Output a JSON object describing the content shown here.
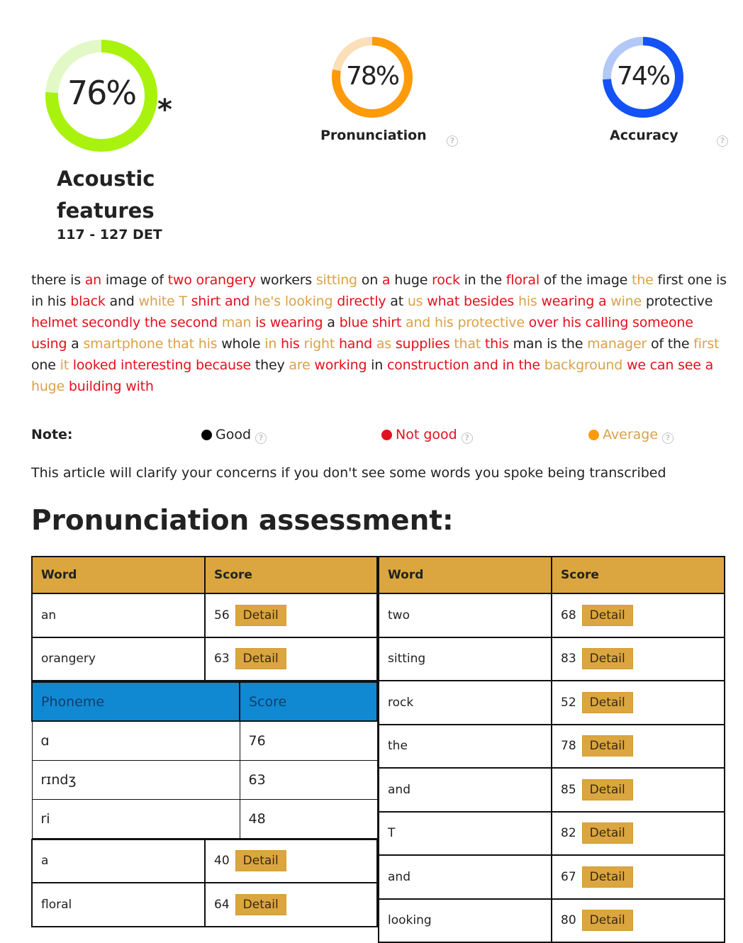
{
  "scores": {
    "overall": {
      "value": 76,
      "display": "76%",
      "marker": "*",
      "label_line1": "Acoustic",
      "label_line2": "features",
      "range": "117 - 127 DET",
      "color": "#a8f20e",
      "track_color": "#e2f9c7"
    },
    "pronunciation": {
      "value": 78,
      "display": "78%",
      "label": "Pronunciation",
      "color": "#ff9a0a",
      "track_color": "#fbdfb8"
    },
    "accuracy": {
      "value": 74,
      "display": "74%",
      "label": "Accuracy",
      "color": "#1452f5",
      "track_color": "#b3c8f7"
    },
    "help_glyph": "?"
  },
  "transcript": [
    {
      "t": "there",
      "q": "good"
    },
    {
      "t": "is",
      "q": "good"
    },
    {
      "t": "an",
      "q": "bad"
    },
    {
      "t": "image",
      "q": "good"
    },
    {
      "t": "of",
      "q": "good"
    },
    {
      "t": "two",
      "q": "bad"
    },
    {
      "t": "orangery",
      "q": "bad"
    },
    {
      "t": "workers",
      "q": "good"
    },
    {
      "t": "sitting",
      "q": "avg"
    },
    {
      "t": "on",
      "q": "good"
    },
    {
      "t": "a",
      "q": "bad"
    },
    {
      "t": "huge",
      "q": "good"
    },
    {
      "t": "rock",
      "q": "bad"
    },
    {
      "t": "in",
      "q": "good"
    },
    {
      "t": "the",
      "q": "good"
    },
    {
      "t": "floral",
      "q": "bad"
    },
    {
      "t": "of",
      "q": "good"
    },
    {
      "t": "the",
      "q": "good"
    },
    {
      "t": "image",
      "q": "good"
    },
    {
      "t": "the",
      "q": "avg"
    },
    {
      "t": "first",
      "q": "good"
    },
    {
      "t": "one",
      "q": "good"
    },
    {
      "t": "is",
      "q": "good"
    },
    {
      "t": "in",
      "q": "good"
    },
    {
      "t": "his",
      "q": "good"
    },
    {
      "t": "black",
      "q": "bad"
    },
    {
      "t": "and",
      "q": "good"
    },
    {
      "t": "white",
      "q": "avg"
    },
    {
      "t": "T",
      "q": "avg"
    },
    {
      "t": "shirt",
      "q": "bad"
    },
    {
      "t": "and",
      "q": "bad"
    },
    {
      "t": "he's",
      "q": "avg"
    },
    {
      "t": "looking",
      "q": "avg"
    },
    {
      "t": "directly",
      "q": "bad"
    },
    {
      "t": "at",
      "q": "good"
    },
    {
      "t": "us",
      "q": "avg"
    },
    {
      "t": "what",
      "q": "bad"
    },
    {
      "t": "besides",
      "q": "bad"
    },
    {
      "t": "his",
      "q": "avg"
    },
    {
      "t": "wearing",
      "q": "bad"
    },
    {
      "t": "a",
      "q": "bad"
    },
    {
      "t": "wine",
      "q": "avg"
    },
    {
      "t": "protective",
      "q": "good"
    },
    {
      "t": "helmet",
      "q": "bad"
    },
    {
      "t": "secondly",
      "q": "bad"
    },
    {
      "t": "the",
      "q": "bad"
    },
    {
      "t": "second",
      "q": "bad"
    },
    {
      "t": "man",
      "q": "avg"
    },
    {
      "t": "is",
      "q": "bad"
    },
    {
      "t": "wearing",
      "q": "bad"
    },
    {
      "t": "a",
      "q": "good"
    },
    {
      "t": "blue",
      "q": "bad"
    },
    {
      "t": "shirt",
      "q": "bad"
    },
    {
      "t": "and",
      "q": "avg"
    },
    {
      "t": "his",
      "q": "avg"
    },
    {
      "t": "protective",
      "q": "avg"
    },
    {
      "t": "over",
      "q": "bad"
    },
    {
      "t": "his",
      "q": "bad"
    },
    {
      "t": "calling",
      "q": "bad"
    },
    {
      "t": "someone",
      "q": "bad"
    },
    {
      "t": "using",
      "q": "bad"
    },
    {
      "t": "a",
      "q": "good"
    },
    {
      "t": "smartphone",
      "q": "avg"
    },
    {
      "t": "that",
      "q": "avg"
    },
    {
      "t": "his",
      "q": "avg"
    },
    {
      "t": "whole",
      "q": "good"
    },
    {
      "t": "in",
      "q": "avg"
    },
    {
      "t": "his",
      "q": "bad"
    },
    {
      "t": "right",
      "q": "avg"
    },
    {
      "t": "hand",
      "q": "bad"
    },
    {
      "t": "as",
      "q": "avg"
    },
    {
      "t": "supplies",
      "q": "bad"
    },
    {
      "t": "that",
      "q": "avg"
    },
    {
      "t": "this",
      "q": "bad"
    },
    {
      "t": "man",
      "q": "good"
    },
    {
      "t": "is",
      "q": "good"
    },
    {
      "t": "the",
      "q": "good"
    },
    {
      "t": "manager",
      "q": "avg"
    },
    {
      "t": "of",
      "q": "good"
    },
    {
      "t": "the",
      "q": "good"
    },
    {
      "t": "first",
      "q": "avg"
    },
    {
      "t": "one",
      "q": "good"
    },
    {
      "t": "it",
      "q": "avg"
    },
    {
      "t": "looked",
      "q": "bad"
    },
    {
      "t": "interesting",
      "q": "bad"
    },
    {
      "t": "because",
      "q": "bad"
    },
    {
      "t": "they",
      "q": "good"
    },
    {
      "t": "are",
      "q": "avg"
    },
    {
      "t": "working",
      "q": "bad"
    },
    {
      "t": "in",
      "q": "good"
    },
    {
      "t": "construction",
      "q": "bad"
    },
    {
      "t": "and",
      "q": "bad"
    },
    {
      "t": "in",
      "q": "bad"
    },
    {
      "t": "the",
      "q": "bad"
    },
    {
      "t": "background",
      "q": "avg"
    },
    {
      "t": "we",
      "q": "bad"
    },
    {
      "t": "can",
      "q": "bad"
    },
    {
      "t": "see",
      "q": "bad"
    },
    {
      "t": "a",
      "q": "bad"
    },
    {
      "t": "huge",
      "q": "avg"
    },
    {
      "t": "building",
      "q": "bad"
    },
    {
      "t": "with",
      "q": "bad"
    }
  ],
  "legend": {
    "note_label": "Note:",
    "good": {
      "label": "Good",
      "color": "#000000"
    },
    "bad": {
      "label": "Not good",
      "color": "#e3101d"
    },
    "avg": {
      "label": "Average",
      "color": "#ff9a0a"
    }
  },
  "article_note": "This article will clarify your concerns if you don't see some words you spoke being transcribed",
  "assessment": {
    "title": "Pronunciation assessment:",
    "headers": {
      "word": "Word",
      "score": "Score"
    },
    "detail_label": "Detail",
    "left_top": [
      {
        "word": "an",
        "score": "56"
      },
      {
        "word": "orangery",
        "score": "63"
      }
    ],
    "phoneme_table": {
      "headers": {
        "phoneme": "Phoneme",
        "score": "Score"
      },
      "rows": [
        {
          "phoneme": "ɑ",
          "score": "76"
        },
        {
          "phoneme": "rɪndʒ",
          "score": "63"
        },
        {
          "phoneme": "ri",
          "score": "48"
        }
      ]
    },
    "left_bottom": [
      {
        "word": "a",
        "score": "40"
      },
      {
        "word": "floral",
        "score": "64"
      }
    ],
    "right": [
      {
        "word": "two",
        "score": "68"
      },
      {
        "word": "sitting",
        "score": "83"
      },
      {
        "word": "rock",
        "score": "52"
      },
      {
        "word": "the",
        "score": "78"
      },
      {
        "word": "and",
        "score": "85"
      },
      {
        "word": "T",
        "score": "82"
      },
      {
        "word": "and",
        "score": "67"
      },
      {
        "word": "looking",
        "score": "80"
      }
    ]
  }
}
